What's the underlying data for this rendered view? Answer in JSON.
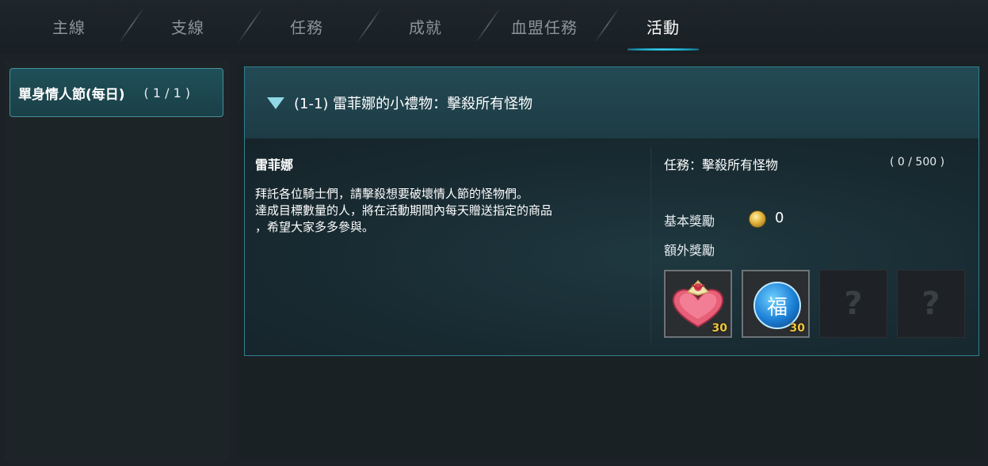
{
  "tabs": [
    {
      "label": "主線",
      "active": false
    },
    {
      "label": "支線",
      "active": false
    },
    {
      "label": "任務",
      "active": false
    },
    {
      "label": "成就",
      "active": false
    },
    {
      "label": "血盟任務",
      "active": false
    },
    {
      "label": "活動",
      "active": true
    }
  ],
  "left_list": {
    "items": [
      {
        "name": "單身情人節(每日)",
        "count": "( 1 / 1 )"
      }
    ]
  },
  "quest": {
    "title": "(1-1) 雷菲娜的小禮物：擊殺所有怪物",
    "npc": "雷菲娜",
    "description": "拜託各位騎士們，請擊殺想要破壞情人節的怪物們。\n達成目標數量的人，將在活動期間內每天贈送指定的商品\n，希望大家多多參與。",
    "objective": "任務：擊殺所有怪物",
    "progress": "( 0 / 500 )",
    "basic_reward_label": "基本獎勵",
    "basic_reward_value": "0",
    "extra_reward_label": "額外獎勵",
    "reward_slots": [
      {
        "icon": "heart-chocolate-box-icon",
        "qty": "30"
      },
      {
        "icon": "fu-coin-icon",
        "glyph": "福",
        "qty": "30"
      },
      {
        "icon": "locked-mystery-icon",
        "qty": ""
      },
      {
        "icon": "locked-mystery-icon",
        "qty": ""
      }
    ]
  }
}
